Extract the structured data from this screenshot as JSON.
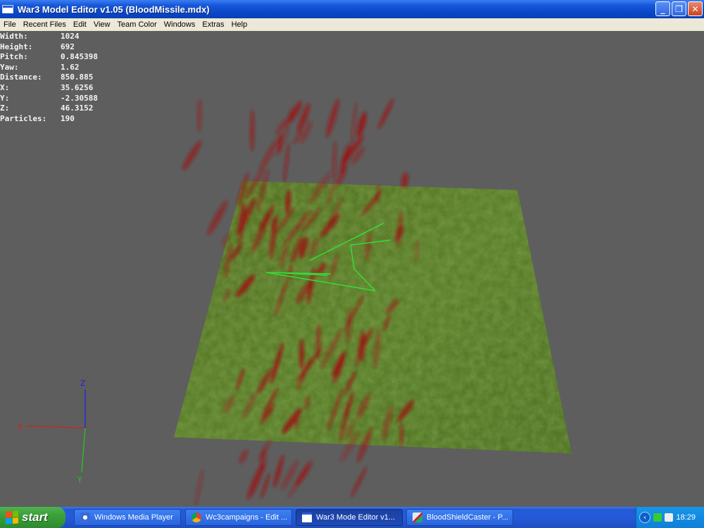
{
  "window": {
    "title": "War3 Model Editor v1.05 (BloodMissile.mdx)",
    "buttons": [
      "minimize",
      "restore",
      "close"
    ]
  },
  "menubar": {
    "items": [
      "File",
      "Recent Files",
      "Edit",
      "View",
      "Team Color",
      "Windows",
      "Extras",
      "Help"
    ]
  },
  "stats": [
    {
      "label": "Width:",
      "value": "1024"
    },
    {
      "label": "Height:",
      "value": "692"
    },
    {
      "label": "Pitch:",
      "value": "0.845398"
    },
    {
      "label": "Yaw:",
      "value": "1.62"
    },
    {
      "label": "Distance:",
      "value": "850.885"
    },
    {
      "label": "X:",
      "value": "35.6256"
    },
    {
      "label": "Y:",
      "value": "-2.30588"
    },
    {
      "label": "Z:",
      "value": "46.3152"
    },
    {
      "label": "Particles:",
      "value": "190"
    }
  ],
  "axes": {
    "x_label": "X",
    "y_label": "Y",
    "z_label": "Z"
  },
  "colors": {
    "background": "#5e5e5e",
    "grass": "#4a6a1e",
    "blood": "#9b1414",
    "bones": "#33e03a",
    "x_axis": "#d42020",
    "y_axis": "#22c822",
    "z_axis": "#2222d8"
  },
  "taskbar": {
    "start_label": "start",
    "tasks": [
      {
        "label": "Windows Media Player",
        "icon": "media-player-icon"
      },
      {
        "label": "Wc3campaigns - Edit ...",
        "icon": "browser-icon"
      },
      {
        "label": "War3 Mode Editor v1...",
        "icon": "window-icon",
        "active": true
      },
      {
        "label": "BloodShieldCaster - P...",
        "icon": "paint-icon"
      }
    ],
    "clock": "18:29"
  }
}
